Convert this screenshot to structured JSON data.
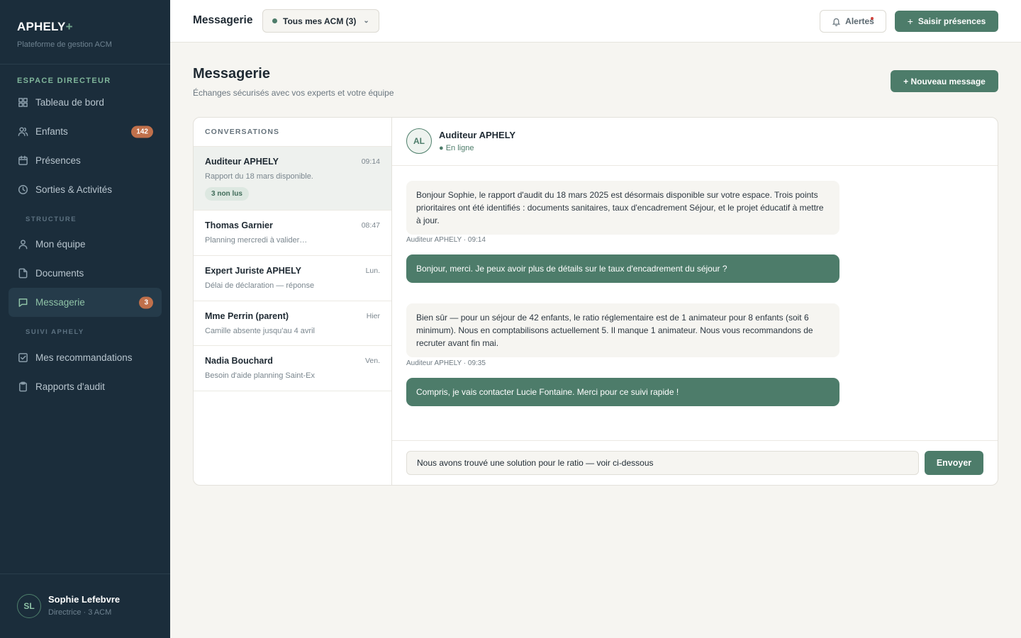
{
  "brand": {
    "name": "APHELY",
    "plus": "+",
    "subtitle": "Plateforme de gestion ACM"
  },
  "sidebar": {
    "section_main": "ESPACE DIRECTEUR",
    "section_structure": "STRUCTURE",
    "section_suivi": "SUIVI APHELY",
    "items": [
      {
        "label": "Tableau de bord",
        "icon": "grid-icon"
      },
      {
        "label": "Enfants",
        "icon": "users-icon",
        "badge": "142"
      },
      {
        "label": "Présences",
        "icon": "calendar-icon"
      },
      {
        "label": "Sorties & Activités",
        "icon": "clock-icon"
      },
      {
        "label": "Mon équipe",
        "icon": "user-icon"
      },
      {
        "label": "Documents",
        "icon": "file-icon"
      },
      {
        "label": "Messagerie",
        "icon": "message-icon",
        "badge": "3",
        "active": true
      },
      {
        "label": "Mes recommandations",
        "icon": "checkbox-icon"
      },
      {
        "label": "Rapports d'audit",
        "icon": "clipboard-icon"
      }
    ]
  },
  "user": {
    "initials": "SL",
    "name": "Sophie Lefebvre",
    "role": "Directrice · 3 ACM"
  },
  "topbar": {
    "title": "Messagerie",
    "acm_select": "Tous mes ACM (3)",
    "alerts": "Alertes",
    "presence_button": "Saisir présences"
  },
  "header": {
    "title": "Messagerie",
    "subtitle": "Échanges sécurisés avec vos experts et votre équipe",
    "new_message": "+ Nouveau message"
  },
  "conversations": {
    "heading": "CONVERSATIONS",
    "items": [
      {
        "name": "Auditeur APHELY",
        "time": "09:14",
        "preview": "Rapport du 18 mars disponible.",
        "unread": "3 non lus"
      },
      {
        "name": "Thomas Garnier",
        "time": "08:47",
        "preview": "Planning mercredi à valider…"
      },
      {
        "name": "Expert Juriste APHELY",
        "time": "Lun.",
        "preview": "Délai de déclaration — réponse"
      },
      {
        "name": "Mme Perrin (parent)",
        "time": "Hier",
        "preview": "Camille absente jusqu'au 4 avril"
      },
      {
        "name": "Nadia Bouchard",
        "time": "Ven.",
        "preview": "Besoin d'aide planning Saint-Ex"
      }
    ]
  },
  "chat": {
    "initials": "AL",
    "name": "Auditeur APHELY",
    "status": "● En ligne",
    "messages": [
      {
        "text": "Bonjour Sophie, le rapport d'audit du 18 mars 2025 est désormais disponible sur votre espace. Trois points prioritaires ont été identifiés : documents sanitaires, taux d'encadrement Séjour, et le projet éducatif à mettre à jour.",
        "meta": "Auditeur APHELY · 09:14"
      },
      {
        "text": "Bonjour, merci. Je peux avoir plus de détails sur le taux d'encadrement du séjour ?"
      },
      {
        "text": "Bien sûr — pour un séjour de 42 enfants, le ratio réglementaire est de 1 animateur pour 8 enfants (soit 6 minimum). Nous en comptabilisons actuellement 5. Il manque 1 animateur. Nous vous recommandons de recruter avant fin mai.",
        "meta": "Auditeur APHELY · 09:35"
      },
      {
        "text": "Compris, je vais contacter Lucie Fontaine. Merci pour ce suivi rapide !"
      }
    ],
    "input_value": "Nous avons trouvé une solution pour le ratio — voir ci-dessous",
    "send": "Envoyer"
  },
  "colors": {
    "sidebar": "#1b2d3b",
    "accent": "#4d7c6a",
    "badge": "#c0704b",
    "background": "#f6f5f1"
  }
}
